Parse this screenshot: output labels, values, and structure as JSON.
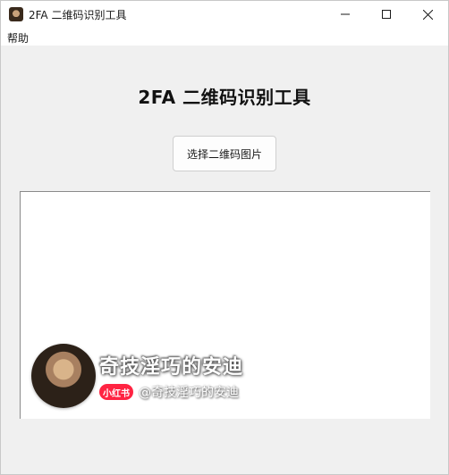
{
  "window": {
    "title": "2FA 二维码识别工具"
  },
  "menubar": {
    "help_label": "帮助"
  },
  "main": {
    "heading": "2FA 二维码识别工具",
    "select_button_label": "选择二维码图片"
  },
  "watermark": {
    "name": "奇技淫巧的安迪",
    "badge": "小红书",
    "handle": "@奇技淫巧的安迪"
  },
  "icons": {
    "app": "app-icon",
    "minimize": "minimize-icon",
    "maximize": "maximize-icon",
    "close": "close-icon"
  }
}
